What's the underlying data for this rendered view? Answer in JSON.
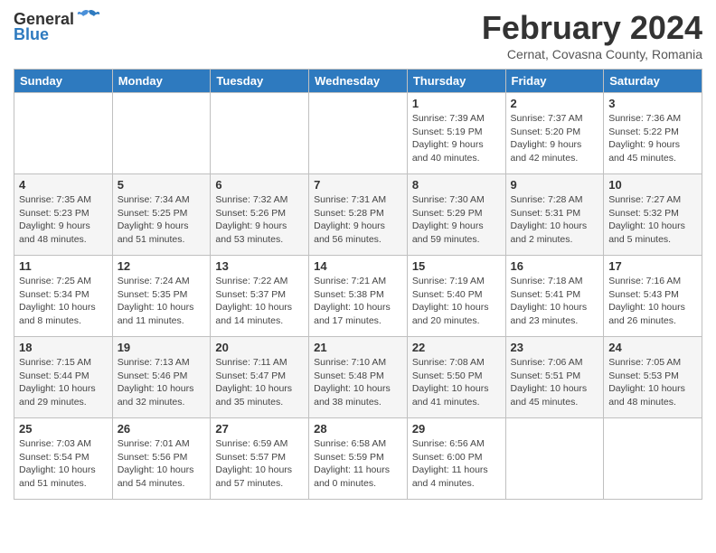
{
  "header": {
    "logo_general": "General",
    "logo_blue": "Blue",
    "month_title": "February 2024",
    "location": "Cernat, Covasna County, Romania"
  },
  "days_of_week": [
    "Sunday",
    "Monday",
    "Tuesday",
    "Wednesday",
    "Thursday",
    "Friday",
    "Saturday"
  ],
  "weeks": [
    [
      {
        "day": "",
        "info": ""
      },
      {
        "day": "",
        "info": ""
      },
      {
        "day": "",
        "info": ""
      },
      {
        "day": "",
        "info": ""
      },
      {
        "day": "1",
        "info": "Sunrise: 7:39 AM\nSunset: 5:19 PM\nDaylight: 9 hours\nand 40 minutes."
      },
      {
        "day": "2",
        "info": "Sunrise: 7:37 AM\nSunset: 5:20 PM\nDaylight: 9 hours\nand 42 minutes."
      },
      {
        "day": "3",
        "info": "Sunrise: 7:36 AM\nSunset: 5:22 PM\nDaylight: 9 hours\nand 45 minutes."
      }
    ],
    [
      {
        "day": "4",
        "info": "Sunrise: 7:35 AM\nSunset: 5:23 PM\nDaylight: 9 hours\nand 48 minutes."
      },
      {
        "day": "5",
        "info": "Sunrise: 7:34 AM\nSunset: 5:25 PM\nDaylight: 9 hours\nand 51 minutes."
      },
      {
        "day": "6",
        "info": "Sunrise: 7:32 AM\nSunset: 5:26 PM\nDaylight: 9 hours\nand 53 minutes."
      },
      {
        "day": "7",
        "info": "Sunrise: 7:31 AM\nSunset: 5:28 PM\nDaylight: 9 hours\nand 56 minutes."
      },
      {
        "day": "8",
        "info": "Sunrise: 7:30 AM\nSunset: 5:29 PM\nDaylight: 9 hours\nand 59 minutes."
      },
      {
        "day": "9",
        "info": "Sunrise: 7:28 AM\nSunset: 5:31 PM\nDaylight: 10 hours\nand 2 minutes."
      },
      {
        "day": "10",
        "info": "Sunrise: 7:27 AM\nSunset: 5:32 PM\nDaylight: 10 hours\nand 5 minutes."
      }
    ],
    [
      {
        "day": "11",
        "info": "Sunrise: 7:25 AM\nSunset: 5:34 PM\nDaylight: 10 hours\nand 8 minutes."
      },
      {
        "day": "12",
        "info": "Sunrise: 7:24 AM\nSunset: 5:35 PM\nDaylight: 10 hours\nand 11 minutes."
      },
      {
        "day": "13",
        "info": "Sunrise: 7:22 AM\nSunset: 5:37 PM\nDaylight: 10 hours\nand 14 minutes."
      },
      {
        "day": "14",
        "info": "Sunrise: 7:21 AM\nSunset: 5:38 PM\nDaylight: 10 hours\nand 17 minutes."
      },
      {
        "day": "15",
        "info": "Sunrise: 7:19 AM\nSunset: 5:40 PM\nDaylight: 10 hours\nand 20 minutes."
      },
      {
        "day": "16",
        "info": "Sunrise: 7:18 AM\nSunset: 5:41 PM\nDaylight: 10 hours\nand 23 minutes."
      },
      {
        "day": "17",
        "info": "Sunrise: 7:16 AM\nSunset: 5:43 PM\nDaylight: 10 hours\nand 26 minutes."
      }
    ],
    [
      {
        "day": "18",
        "info": "Sunrise: 7:15 AM\nSunset: 5:44 PM\nDaylight: 10 hours\nand 29 minutes."
      },
      {
        "day": "19",
        "info": "Sunrise: 7:13 AM\nSunset: 5:46 PM\nDaylight: 10 hours\nand 32 minutes."
      },
      {
        "day": "20",
        "info": "Sunrise: 7:11 AM\nSunset: 5:47 PM\nDaylight: 10 hours\nand 35 minutes."
      },
      {
        "day": "21",
        "info": "Sunrise: 7:10 AM\nSunset: 5:48 PM\nDaylight: 10 hours\nand 38 minutes."
      },
      {
        "day": "22",
        "info": "Sunrise: 7:08 AM\nSunset: 5:50 PM\nDaylight: 10 hours\nand 41 minutes."
      },
      {
        "day": "23",
        "info": "Sunrise: 7:06 AM\nSunset: 5:51 PM\nDaylight: 10 hours\nand 45 minutes."
      },
      {
        "day": "24",
        "info": "Sunrise: 7:05 AM\nSunset: 5:53 PM\nDaylight: 10 hours\nand 48 minutes."
      }
    ],
    [
      {
        "day": "25",
        "info": "Sunrise: 7:03 AM\nSunset: 5:54 PM\nDaylight: 10 hours\nand 51 minutes."
      },
      {
        "day": "26",
        "info": "Sunrise: 7:01 AM\nSunset: 5:56 PM\nDaylight: 10 hours\nand 54 minutes."
      },
      {
        "day": "27",
        "info": "Sunrise: 6:59 AM\nSunset: 5:57 PM\nDaylight: 10 hours\nand 57 minutes."
      },
      {
        "day": "28",
        "info": "Sunrise: 6:58 AM\nSunset: 5:59 PM\nDaylight: 11 hours\nand 0 minutes."
      },
      {
        "day": "29",
        "info": "Sunrise: 6:56 AM\nSunset: 6:00 PM\nDaylight: 11 hours\nand 4 minutes."
      },
      {
        "day": "",
        "info": ""
      },
      {
        "day": "",
        "info": ""
      }
    ]
  ]
}
